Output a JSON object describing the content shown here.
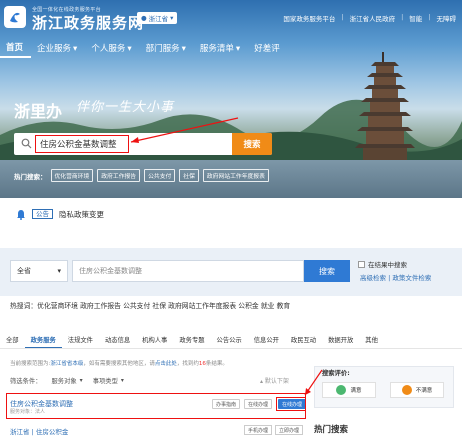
{
  "header": {
    "site_subtitle": "全国一体化在线政务服务平台",
    "site_title": "浙江政务服务网",
    "region": "浙江省",
    "top_links": [
      "国家政务服务平台",
      "浙江省人民政府",
      "智能",
      "无障碍"
    ]
  },
  "nav": {
    "items": [
      "首页",
      "企业服务",
      "个人服务",
      "部门服务",
      "服务清单",
      "好差评"
    ]
  },
  "hero": {
    "slogan_left": "浙里办",
    "slogan_right": "伴你一生大小事",
    "search_value": "住房公积金基数调整",
    "search_button": "搜索",
    "hot_label": "热门搜索：",
    "hot_tags": [
      "优化营商环境",
      "政府工作报告",
      "公共支付",
      "社保",
      "政府网站工作年度报表"
    ]
  },
  "notice": {
    "tag": "公告",
    "text": "隐私政策变更"
  },
  "results_page": {
    "region_select": "全省",
    "search_placeholder": "住房公积金基数调整",
    "search_button": "搜索",
    "in_results_label": "在结果中搜索",
    "advanced_links": "高级检索 | 政策文件检索",
    "hot_line": "热搜词：优化营商环境 政府工作报告 公共支付 社保 政府网站工作年度报表 公积金 就业 教育",
    "tabs": [
      "全部",
      "政务服务",
      "法规文件",
      "动态信息",
      "机构人事",
      "政务专题",
      "公告公示",
      "信息公开",
      "政民互动",
      "数据开放",
      "其他"
    ],
    "result_info_prefix": "当前搜索范围为:",
    "result_info_region": "浙江省省本级",
    "result_info_middle": "，如有需要搜索其他地区，请",
    "result_info_link": "点击此处",
    "result_info_suffix": "，找到约",
    "result_info_count": "16",
    "result_info_end": "条结果。",
    "filter_label": "筛选条件：",
    "filter_options": [
      "服务对象",
      "事项类型"
    ],
    "sort_label": "默认下架",
    "result1": {
      "title": "住房公积金基数调整",
      "meta": "服务对象：法人",
      "buttons": [
        "办事指南",
        "在线办理",
        "在线办理"
      ]
    },
    "result2": {
      "title": "浙江省 | 住房公积金",
      "buttons": [
        "手机办理",
        "立即办理"
      ]
    },
    "eval_label": "搜索评价:",
    "eval_good": "满意",
    "eval_bad": "不满意",
    "hot_search_title": "热门搜索"
  },
  "colors": {
    "brand_blue": "#2f6fb5",
    "search_orange": "#f08b17",
    "highlight_red": "#e11"
  }
}
